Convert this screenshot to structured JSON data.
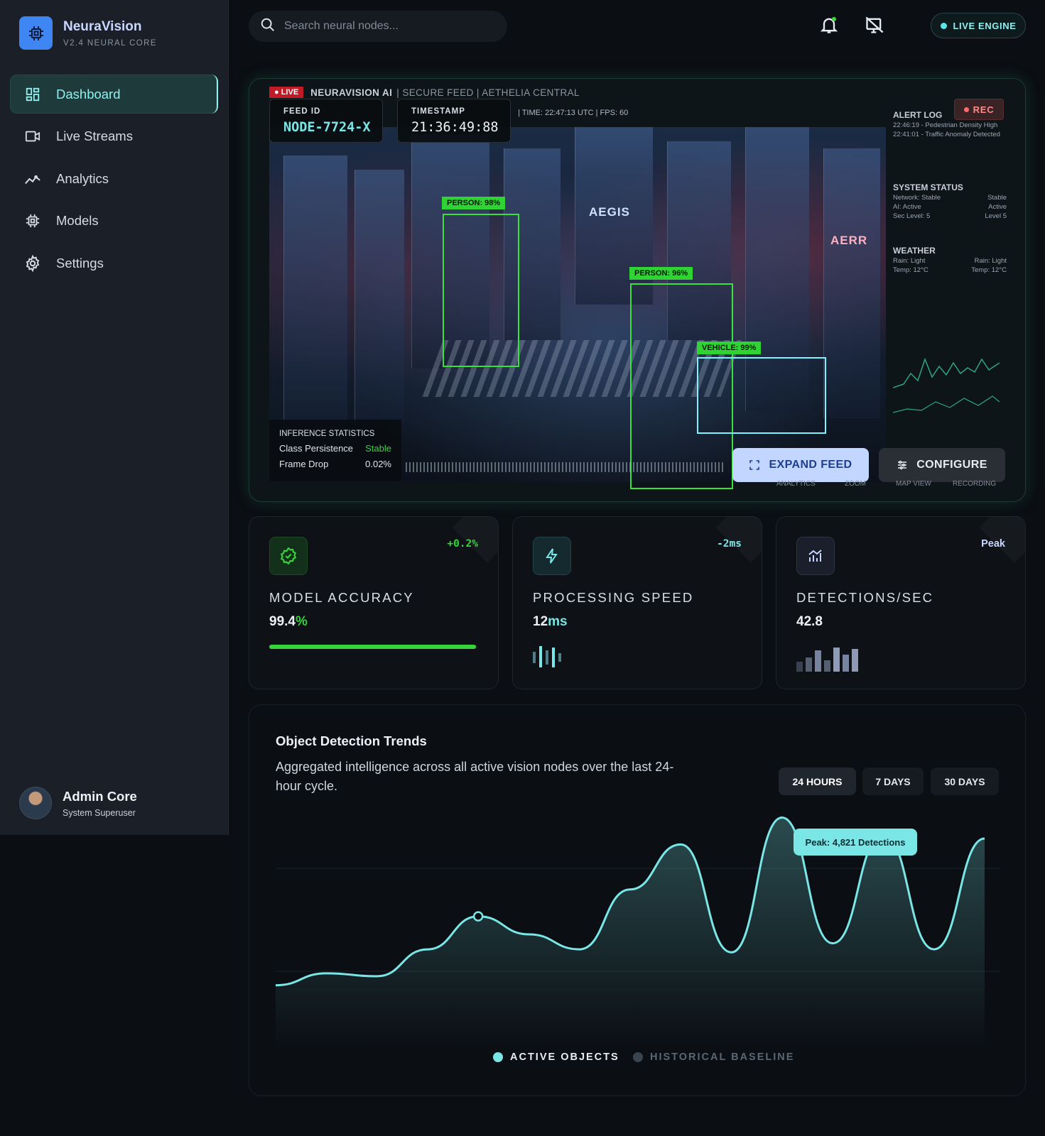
{
  "brand": {
    "name": "NeuraVision",
    "version": "V2.4 NEURAL CORE"
  },
  "nav": [
    {
      "label": "Dashboard",
      "icon": "dashboard-grid-icon",
      "active": true
    },
    {
      "label": "Live Streams",
      "icon": "video-camera-icon",
      "active": false
    },
    {
      "label": "Analytics",
      "icon": "analytics-trend-icon",
      "active": false
    },
    {
      "label": "Models",
      "icon": "chip-icon",
      "active": false
    },
    {
      "label": "Settings",
      "icon": "gear-icon",
      "active": false
    }
  ],
  "user": {
    "name": "Admin Core",
    "role": "System Superuser"
  },
  "search": {
    "placeholder": "Search neural nodes..."
  },
  "header": {
    "engine_status": "LIVE ENGINE"
  },
  "feed": {
    "live_tag": "LIVE",
    "title": "NEURAVISION AI",
    "subtitle": "| SECURE FEED | AETHELIA CENTRAL",
    "meta": "| TIME: 22:47:13 UTC | FPS: 60",
    "feed_id_label": "FEED ID",
    "feed_id": "NODE-7724-X",
    "timestamp_label": "TIMESTAMP",
    "timestamp": "21:36:49:88",
    "rec_label": "REC",
    "detections": [
      {
        "label": "PERSON: 98%",
        "class": "person",
        "confidence": 98
      },
      {
        "label": "PERSON: 96%",
        "class": "person",
        "confidence": 96
      },
      {
        "label": "VEHICLE: 99%",
        "class": "vehicle",
        "confidence": 99
      }
    ],
    "alert_log": {
      "title": "ALERT LOG",
      "entries": [
        "22:46:19 - Pedestrian Density High",
        "22:41:01 - Traffic Anomaly Detected"
      ]
    },
    "system_status": {
      "title": "SYSTEM STATUS",
      "rows": [
        [
          "Network: Stable",
          "Stable"
        ],
        [
          "AI: Active",
          "Active"
        ],
        [
          "Sec Level: 5",
          "Level 5"
        ]
      ]
    },
    "weather": {
      "title": "WEATHER",
      "rows": [
        [
          "Rain: Light",
          "Rain: Light"
        ],
        [
          "Temp: 12°C",
          "Temp: 12°C"
        ]
      ]
    },
    "inference": {
      "title": "INFERENCE STATISTICS",
      "persistence_label": "Class Persistence",
      "persistence_value": "Stable",
      "frame_drop_label": "Frame Drop",
      "frame_drop_value": "0.02%"
    },
    "expand_label": "EXPAND FEED",
    "configure_label": "CONFIGURE",
    "footer_tabs": [
      "ANALYTICS",
      "ZOOM",
      "MAP VIEW",
      "RECORDING"
    ]
  },
  "metrics": [
    {
      "label": "MODEL ACCURACY",
      "value": "99.4",
      "unit": "%",
      "delta": "+0.2%",
      "icon": "verified-badge-icon",
      "progress": 99.4
    },
    {
      "label": "PROCESSING SPEED",
      "value": "12",
      "unit": "ms",
      "delta": "-2ms",
      "icon": "lightning-icon"
    },
    {
      "label": "DETECTIONS/SEC",
      "value": "42.8",
      "unit": "",
      "delta": "Peak",
      "icon": "bar-chart-icon"
    }
  ],
  "colors": {
    "accent": "#7ae6e6",
    "success": "#35d43a",
    "brand": "#3f86f5",
    "alert": "#c01c28"
  },
  "trends": {
    "title": "Object Detection Trends",
    "subtitle": "Aggregated intelligence across all active vision nodes over the last 24-hour cycle.",
    "ranges": [
      "24 HOURS",
      "7 DAYS",
      "30 DAYS"
    ],
    "active_range": "24 HOURS",
    "tooltip": "Peak: 4,821 Detections",
    "legend": [
      "ACTIVE OBJECTS",
      "HISTORICAL BASELINE"
    ]
  },
  "chart_data": {
    "type": "area",
    "title": "Object Detection Trends",
    "series": [
      {
        "name": "ACTIVE OBJECTS",
        "values": [
          2300,
          2500,
          2450,
          2900,
          3450,
          3150,
          2900,
          3900,
          4650,
          2850,
          5100,
          3000,
          4820,
          2900,
          4750
        ]
      }
    ],
    "peak": 4821,
    "grid": true
  }
}
